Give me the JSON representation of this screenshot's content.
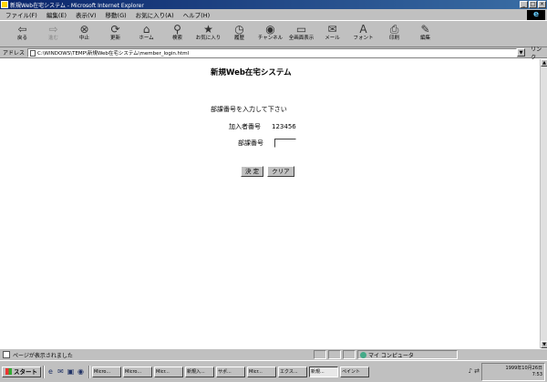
{
  "window": {
    "title": "新規Web在宅システム - Microsoft Internet Explorer"
  },
  "menu": [
    "ファイル(F)",
    "編集(E)",
    "表示(V)",
    "移動(G)",
    "お気に入り(A)",
    "ヘルプ(H)"
  ],
  "toolbar": [
    {
      "icon": "back-icon",
      "label": "戻る",
      "glyph": "⇦",
      "disabled": false
    },
    {
      "icon": "forward-icon",
      "label": "進む",
      "glyph": "⇨",
      "disabled": true
    },
    {
      "icon": "stop-icon",
      "label": "中止",
      "glyph": "⊗",
      "disabled": false
    },
    {
      "icon": "refresh-icon",
      "label": "更新",
      "glyph": "⟳",
      "disabled": false
    },
    {
      "icon": "home-icon",
      "label": "ホーム",
      "glyph": "⌂",
      "disabled": false
    },
    {
      "icon": "search-icon",
      "label": "検索",
      "glyph": "⚲",
      "disabled": false
    },
    {
      "icon": "favorites-icon",
      "label": "お気に入り",
      "glyph": "★",
      "disabled": false
    },
    {
      "icon": "history-icon",
      "label": "履歴",
      "glyph": "◷",
      "disabled": false
    },
    {
      "icon": "channels-icon",
      "label": "チャンネル",
      "glyph": "◉",
      "disabled": false
    },
    {
      "icon": "fullscreen-icon",
      "label": "全画面表示",
      "glyph": "▭",
      "disabled": false
    },
    {
      "icon": "mail-icon",
      "label": "メール",
      "glyph": "✉",
      "disabled": false
    },
    {
      "icon": "fonts-icon",
      "label": "フォント",
      "glyph": "A",
      "disabled": false
    },
    {
      "icon": "print-icon",
      "label": "印刷",
      "glyph": "⎙",
      "disabled": false
    },
    {
      "icon": "edit-icon",
      "label": "編集",
      "glyph": "✎",
      "disabled": false
    }
  ],
  "address": {
    "label": "アドレス",
    "url": "C:\\WINDOWS\\TEMP\\新規Web在宅システム\\member_login.html",
    "links_label": "リンク"
  },
  "page": {
    "title": "新規Web在宅システム",
    "prompt": "部課番号を入力して下さい",
    "member_label": "加入者番号",
    "member_value": "123456",
    "dept_label": "部課番号",
    "dept_value": "",
    "ok_button": "決 定",
    "clear_button": "クリア"
  },
  "status": {
    "text": "ページが表示されました",
    "zone": "マイ コンピュータ"
  },
  "taskbar": {
    "start": "スタート",
    "tasks": [
      {
        "label": "Micro...",
        "active": false
      },
      {
        "label": "Micro...",
        "active": false
      },
      {
        "label": "Micr...",
        "active": false
      },
      {
        "label": "新規入...",
        "active": false
      },
      {
        "label": "サポ...",
        "active": false
      },
      {
        "label": "Micr...",
        "active": false
      },
      {
        "label": "エクス...",
        "active": false
      },
      {
        "label": "新規...",
        "active": true
      },
      {
        "label": "ペイント",
        "active": false
      }
    ],
    "date": "1999年10月26日",
    "time": "7:53"
  }
}
